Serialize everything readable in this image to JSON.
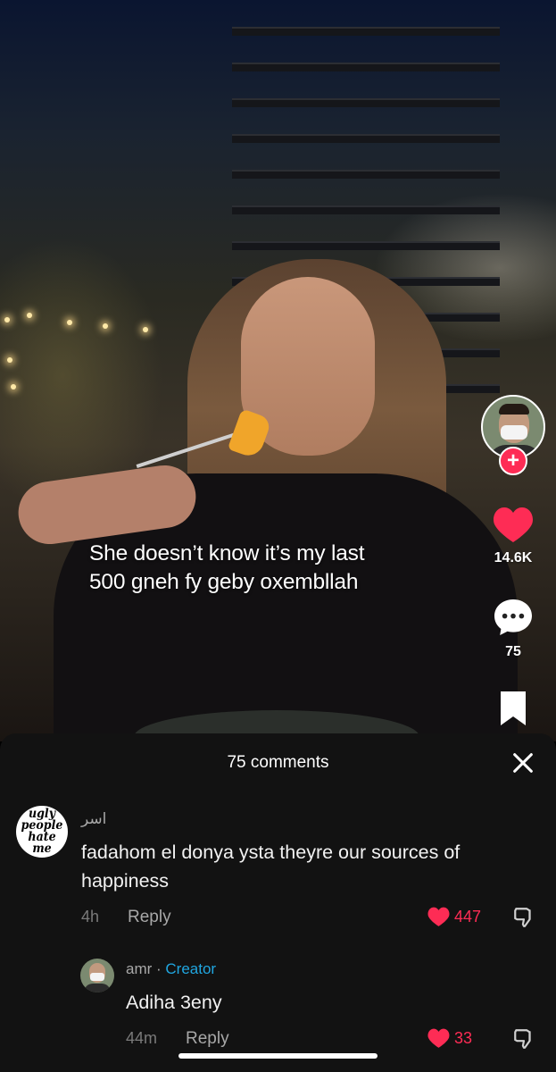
{
  "video": {
    "caption_line1": "She doesn’t know it’s my last",
    "caption_line2": "500 gneh fy geby oxembllah"
  },
  "rail": {
    "likes": "14.6K",
    "comments": "75",
    "like_color": "#fe2c55",
    "follow_symbol": "+"
  },
  "comments_sheet": {
    "title": "75 comments",
    "close_icon": "close-icon",
    "comments": [
      {
        "avatar_text": "ugly people hate me",
        "username": "اسر",
        "text_line1": "fadahom el donya ysta theyre our sources of",
        "text_line2": "happiness",
        "time": "4h",
        "reply_label": "Reply",
        "likes": "447"
      },
      {
        "username": "amr",
        "separator": " · ",
        "creator_label": "Creator",
        "text_line1": "Adiha 3eny",
        "time": "44m",
        "reply_label": "Reply",
        "likes": "33"
      }
    ]
  },
  "colors": {
    "sheet_bg": "#121212",
    "accent_red": "#fe2c55",
    "creator_blue": "#20a6e0"
  }
}
